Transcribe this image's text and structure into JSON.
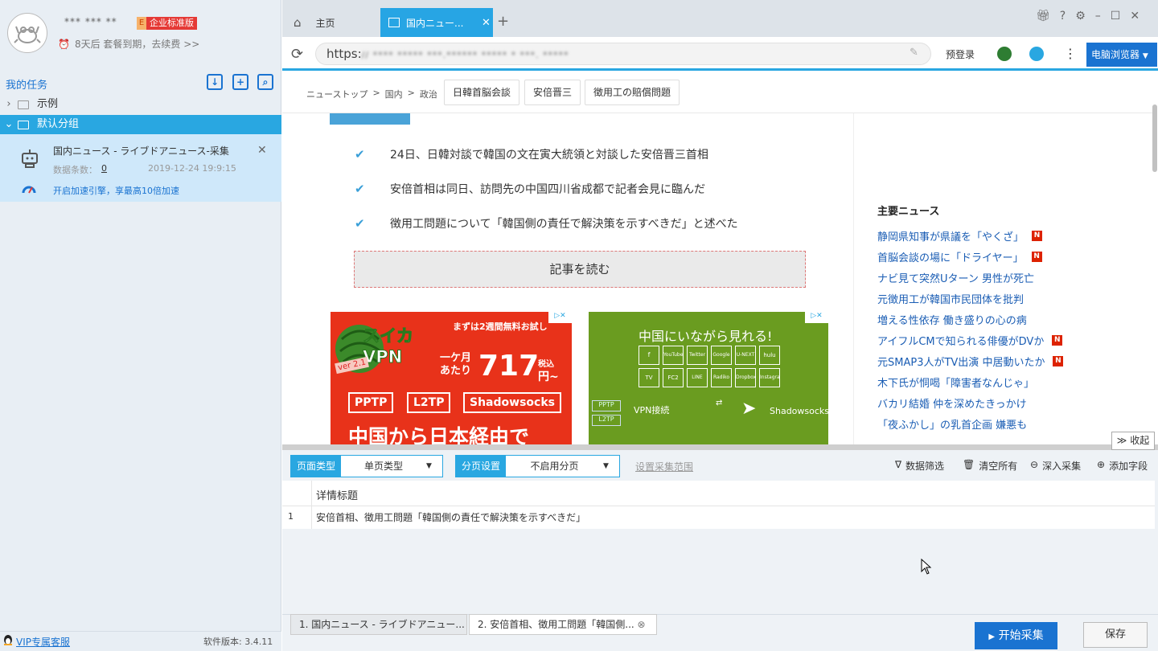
{
  "account": {
    "username": "*** *** **",
    "plan_letter": "E",
    "plan_badge": "企业标准版",
    "expiry": "8天后 套餐到期，去续费 >>"
  },
  "sidebar": {
    "section_title": "我的任务",
    "groups": [
      {
        "label": "示例",
        "expanded": false
      },
      {
        "label": "默认分组",
        "expanded": true
      }
    ],
    "task": {
      "name": "国内ニュース - ライブドアニュース-采集",
      "count_label": "数据条数：",
      "count": "0",
      "date": "2019-12-24 19:9:15",
      "speed_text": "开启加速引擎，享最高10倍加速"
    },
    "vip_label": "VIP专属客服",
    "version": "软件版本: 3.4.11"
  },
  "browser": {
    "tabs": [
      {
        "label": "主页"
      },
      {
        "label": "国内ニュー..."
      }
    ],
    "url_prefix": "https:",
    "url_rest": "// **** ***** ***.****** ***** * ***. *****",
    "login": "预登录",
    "browser_button": "电脑浏览器"
  },
  "page": {
    "breadcrumb": [
      "ニューストップ",
      ">",
      "国内",
      ">",
      "政治"
    ],
    "tags": [
      "日韓首脳会談",
      "安倍晋三",
      "徴用工の賠償問題"
    ],
    "bullets": [
      "24日、日韓対談で韓国の文在寅大統領と対談した安倍晋三首相",
      "安倍首相は同日、訪問先の中国四川省成都で記者会見に臨んだ",
      "徴用工問題について「韓国側の責任で解決策を示すべきだ」と述べた"
    ],
    "read_button": "記事を読む",
    "ad1": {
      "badge": "まずは2週間無料お試し",
      "brand": "スイカ VPN",
      "version": "ver 2.1",
      "price_lead": "一ケ月 あたり",
      "price": "717",
      "price_unit": "円~",
      "price_tax": "税込",
      "protocols": [
        "PPTP",
        "L2TP",
        "Shadowsocks"
      ],
      "headline": "中国から日本経由で"
    },
    "ad2": {
      "headline": "中国にいながら見れる!",
      "services": [
        "f",
        "YouTube",
        "Twitter",
        "Google",
        "U-NEXT",
        "hulu",
        "TV",
        "FC2",
        "LINE",
        "Radiko",
        "Dropbox",
        "Instagram"
      ],
      "vpn_label": "VPN接続",
      "ss_label": "Shadowsocks"
    },
    "news_title": "主要ニュース",
    "news": [
      {
        "text": "静岡県知事が県議を「やくざ」",
        "new": true
      },
      {
        "text": "首脳会談の場に「ドライヤー」",
        "new": true
      },
      {
        "text": "ナビ見て突然Uターン 男性が死亡",
        "new": false
      },
      {
        "text": "元徴用工が韓国市民団体を批判",
        "new": false
      },
      {
        "text": "増える性依存 働き盛りの心の病",
        "new": false
      },
      {
        "text": "アイフルCMで知られる俳優がDVか",
        "new": true
      },
      {
        "text": "元SMAP3人がTV出演 中居動いたか",
        "new": true
      },
      {
        "text": "木下氏が恫喝「障害者なんじゃ」",
        "new": false
      },
      {
        "text": "バカリ結婚 仲を深めたきっかけ",
        "new": false
      },
      {
        "text": "「夜ふかし」の乳首企画 嫌悪も",
        "new": false
      }
    ],
    "news_badge": "N"
  },
  "panel": {
    "collapse_label": "收起",
    "page_type_label": "页面类型",
    "page_type_value": "单页类型",
    "paging_label": "分页设置",
    "paging_value": "不启用分页",
    "range_link": "设置采集范围",
    "tools": [
      "数据筛选",
      "清空所有",
      "深入采集",
      "添加字段"
    ],
    "table": {
      "columns": [
        "详情标题"
      ],
      "rows": [
        {
          "num": "1",
          "title": "安倍首相、徴用工問題「韓国側の責任で解決策を示すべきだ」"
        }
      ]
    },
    "bottom_tabs": [
      "1. 国内ニュース - ライブドアニュー...",
      "2. 安倍首相、徴用工問題「韓国側..."
    ],
    "start_button": "开始采集",
    "save_button": "保存"
  }
}
